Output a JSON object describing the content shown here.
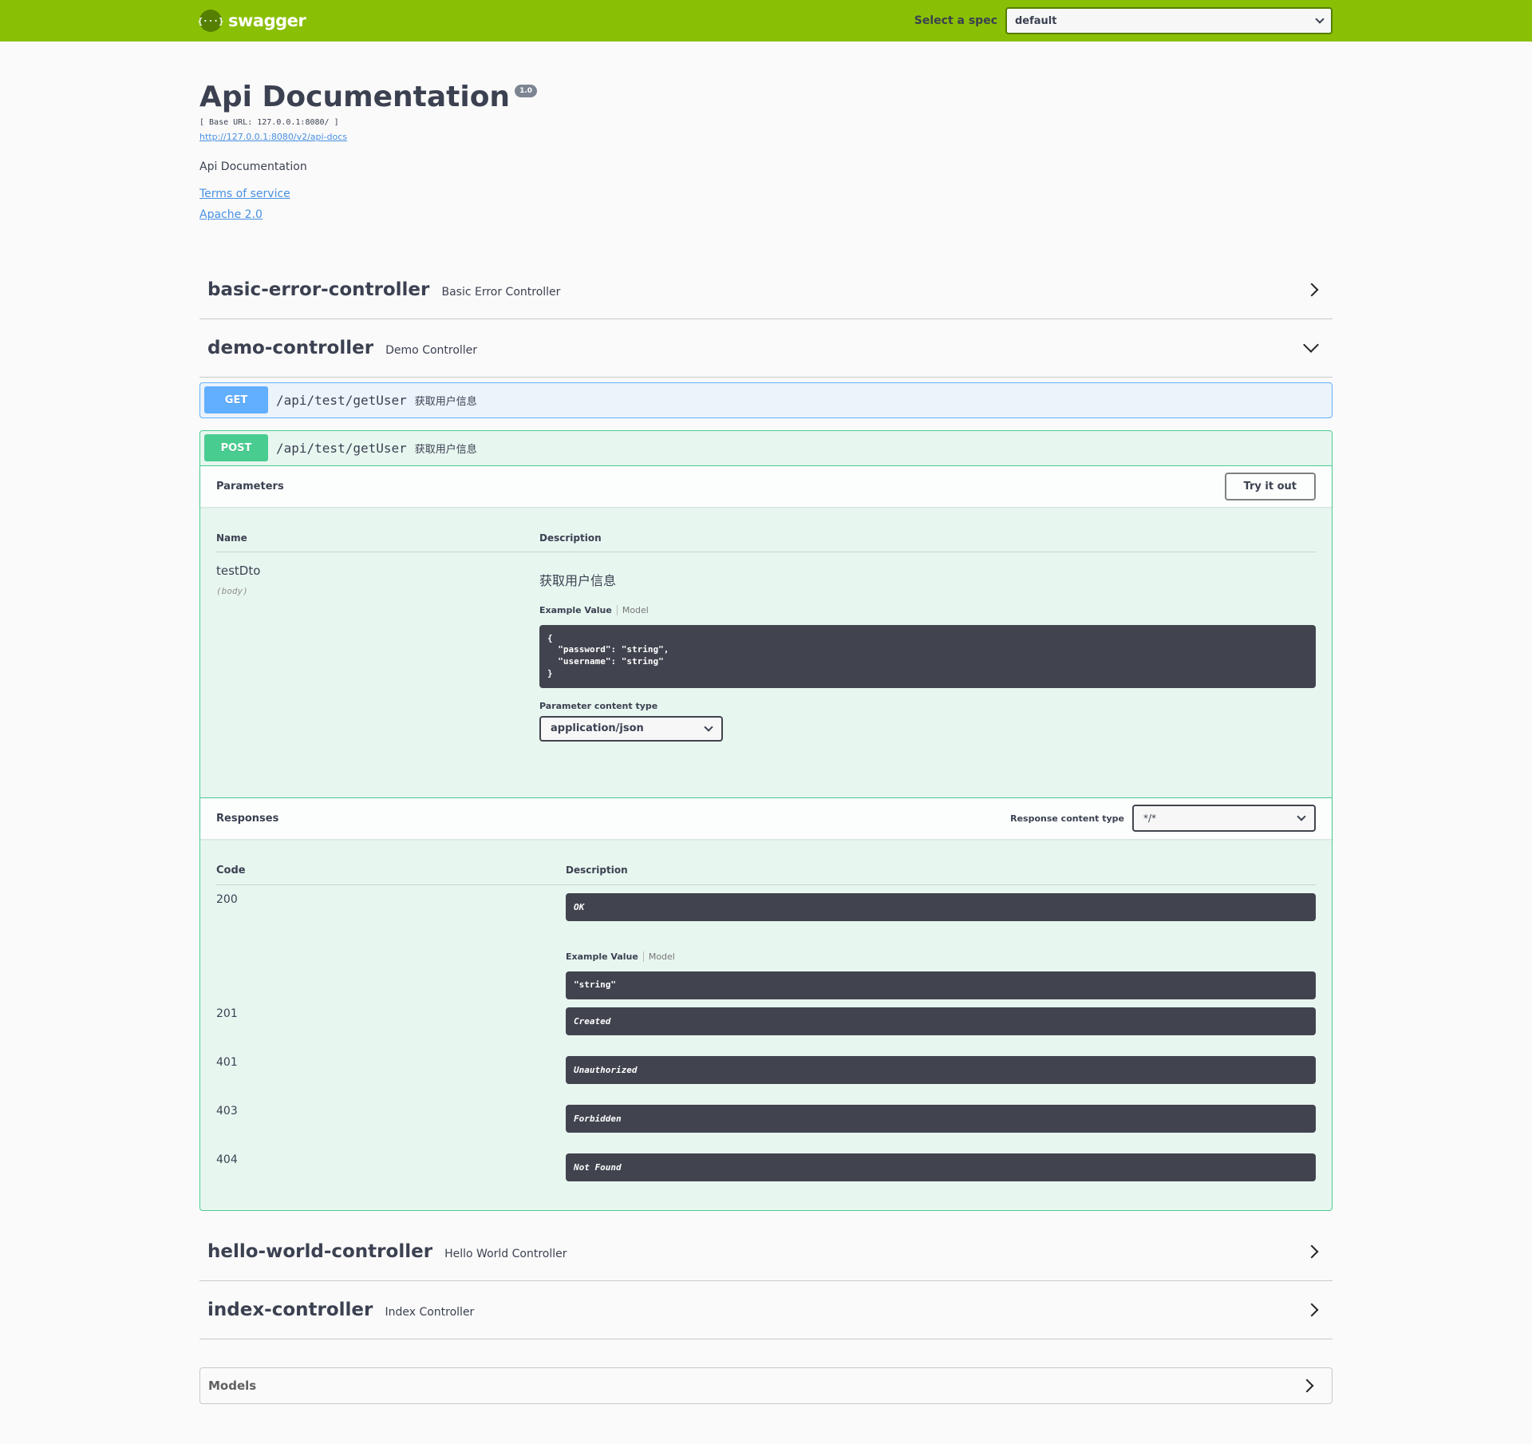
{
  "topbar": {
    "logo_icon": "{···}",
    "logo_text": "swagger",
    "spec_label": "Select a spec",
    "spec_value": "default",
    "brand_color": "#89bf04"
  },
  "info": {
    "title": "Api Documentation",
    "version": "1.0",
    "base_url": "[ Base URL: 127.0.0.1:8080/ ]",
    "api_docs_link": "http://127.0.0.1:8080/v2/api-docs",
    "description": "Api Documentation",
    "terms_of_service": "Terms of service",
    "license": "Apache 2.0"
  },
  "tags": [
    {
      "name": "basic-error-controller",
      "description": "Basic Error Controller",
      "expanded": false
    },
    {
      "name": "demo-controller",
      "description": "Demo Controller",
      "expanded": true
    },
    {
      "name": "hello-world-controller",
      "description": "Hello World Controller",
      "expanded": false
    },
    {
      "name": "index-controller",
      "description": "Index Controller",
      "expanded": false
    }
  ],
  "operations": [
    {
      "method": "GET",
      "path": "/api/test/getUser",
      "summary": "获取用户信息",
      "color": "#61affe"
    },
    {
      "method": "POST",
      "path": "/api/test/getUser",
      "summary": "获取用户信息",
      "color": "#49cc90"
    }
  ],
  "post_detail": {
    "parameters_title": "Parameters",
    "try_it_out": "Try it out",
    "col_name": "Name",
    "col_description": "Description",
    "param": {
      "name": "testDto",
      "in": "(body)",
      "description": "获取用户信息",
      "tab_example": "Example Value",
      "tab_model": "Model",
      "example": "{\n  \"password\": \"string\",\n  \"username\": \"string\"\n}",
      "content_type_label": "Parameter content type",
      "content_type_value": "application/json"
    },
    "responses_title": "Responses",
    "response_ct_label": "Response content type",
    "response_ct_value": "*/*",
    "col_code": "Code",
    "col_resp_description": "Description",
    "responses": [
      {
        "code": "200",
        "description": "OK",
        "tab_example": "Example Value",
        "tab_model": "Model",
        "example": "\"string\""
      },
      {
        "code": "201",
        "description": "Created"
      },
      {
        "code": "401",
        "description": "Unauthorized"
      },
      {
        "code": "403",
        "description": "Forbidden"
      },
      {
        "code": "404",
        "description": "Not Found"
      }
    ]
  },
  "models": {
    "label": "Models"
  }
}
